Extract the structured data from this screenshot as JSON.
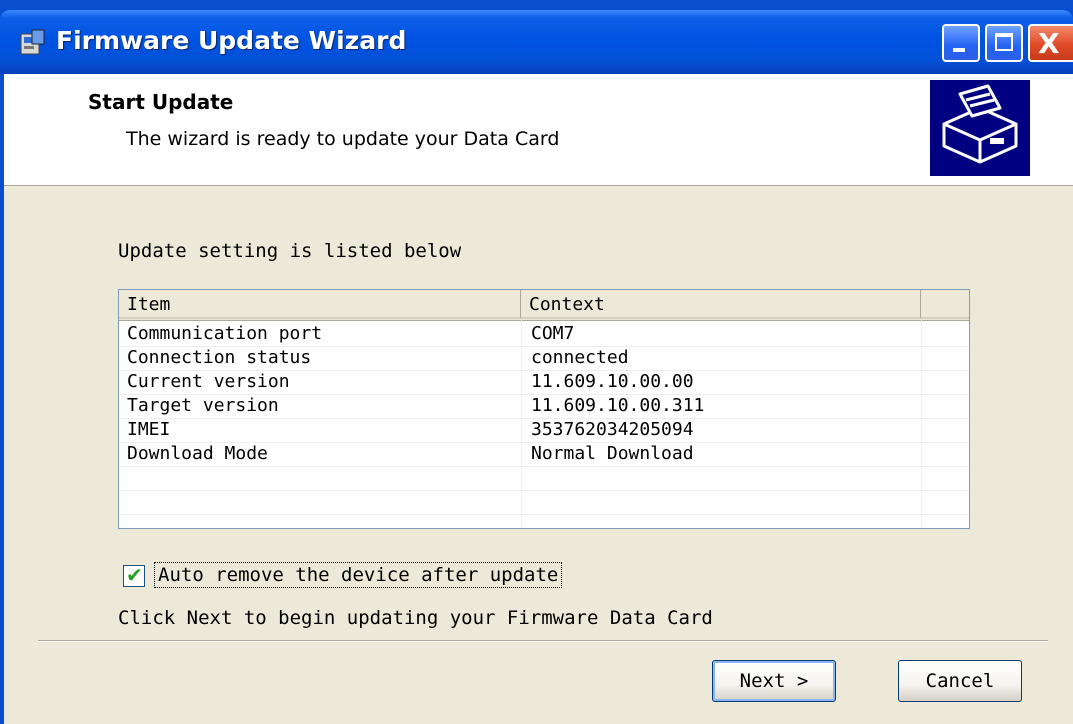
{
  "window": {
    "title": "Firmware Update Wizard",
    "icons": {
      "app": "firmware-app-icon",
      "minimize": "minimize-icon",
      "maximize": "maximize-icon",
      "close": "close-icon"
    },
    "close_glyph": "X"
  },
  "header": {
    "title": "Start Update",
    "subtitle": "The wizard is ready to update your Data Card",
    "image": "device-install-icon"
  },
  "main": {
    "info_label": "Update setting is listed below",
    "table": {
      "columns": [
        "Item",
        "Context"
      ],
      "rows": [
        {
          "item": "Communication port",
          "context": "COM7"
        },
        {
          "item": "Connection status",
          "context": "connected"
        },
        {
          "item": "Current version",
          "context": "11.609.10.00.00"
        },
        {
          "item": "Target version",
          "context": "11.609.10.00.311"
        },
        {
          "item": "IMEI",
          "context": "353762034205094"
        },
        {
          "item": "Download Mode",
          "context": "Normal Download"
        }
      ]
    },
    "checkbox": {
      "label": "Auto remove the device after update",
      "checked": true,
      "mark": "✔"
    },
    "instruction": "Click Next to begin updating your Firmware Data Card"
  },
  "buttons": {
    "next_label": "Next >",
    "cancel_label": "Cancel"
  },
  "colors": {
    "titlebar": "#0054e3",
    "client_bg": "#ece9d8",
    "close_button": "#e04a28",
    "header_image_bg": "#000080"
  }
}
